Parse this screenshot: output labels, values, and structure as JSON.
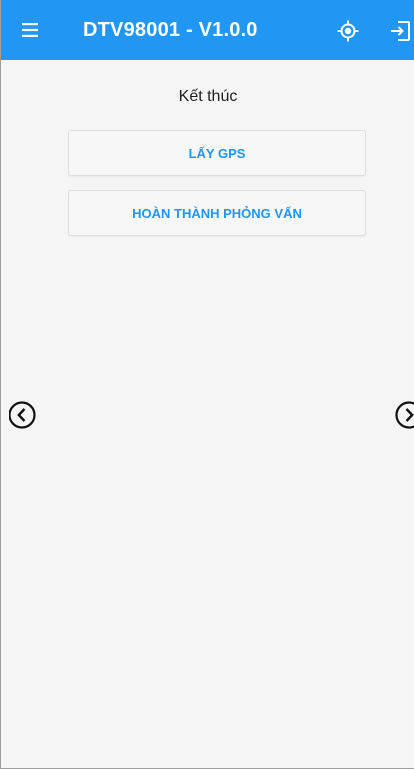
{
  "appbar": {
    "title": "DTV98001 - V1.0.0",
    "color": "#2196f3",
    "icons": {
      "menu": "menu-icon",
      "gps": "gps-target-icon",
      "logout": "logout-icon"
    }
  },
  "content": {
    "heading": "Kết thúc",
    "buttons": {
      "get_gps": "LẤY GPS",
      "finish_interview": "HOÀN THÀNH PHỎNG VẤN"
    },
    "nav": {
      "prev": "chevron-left-circle-icon",
      "next": "chevron-right-circle-icon"
    }
  }
}
